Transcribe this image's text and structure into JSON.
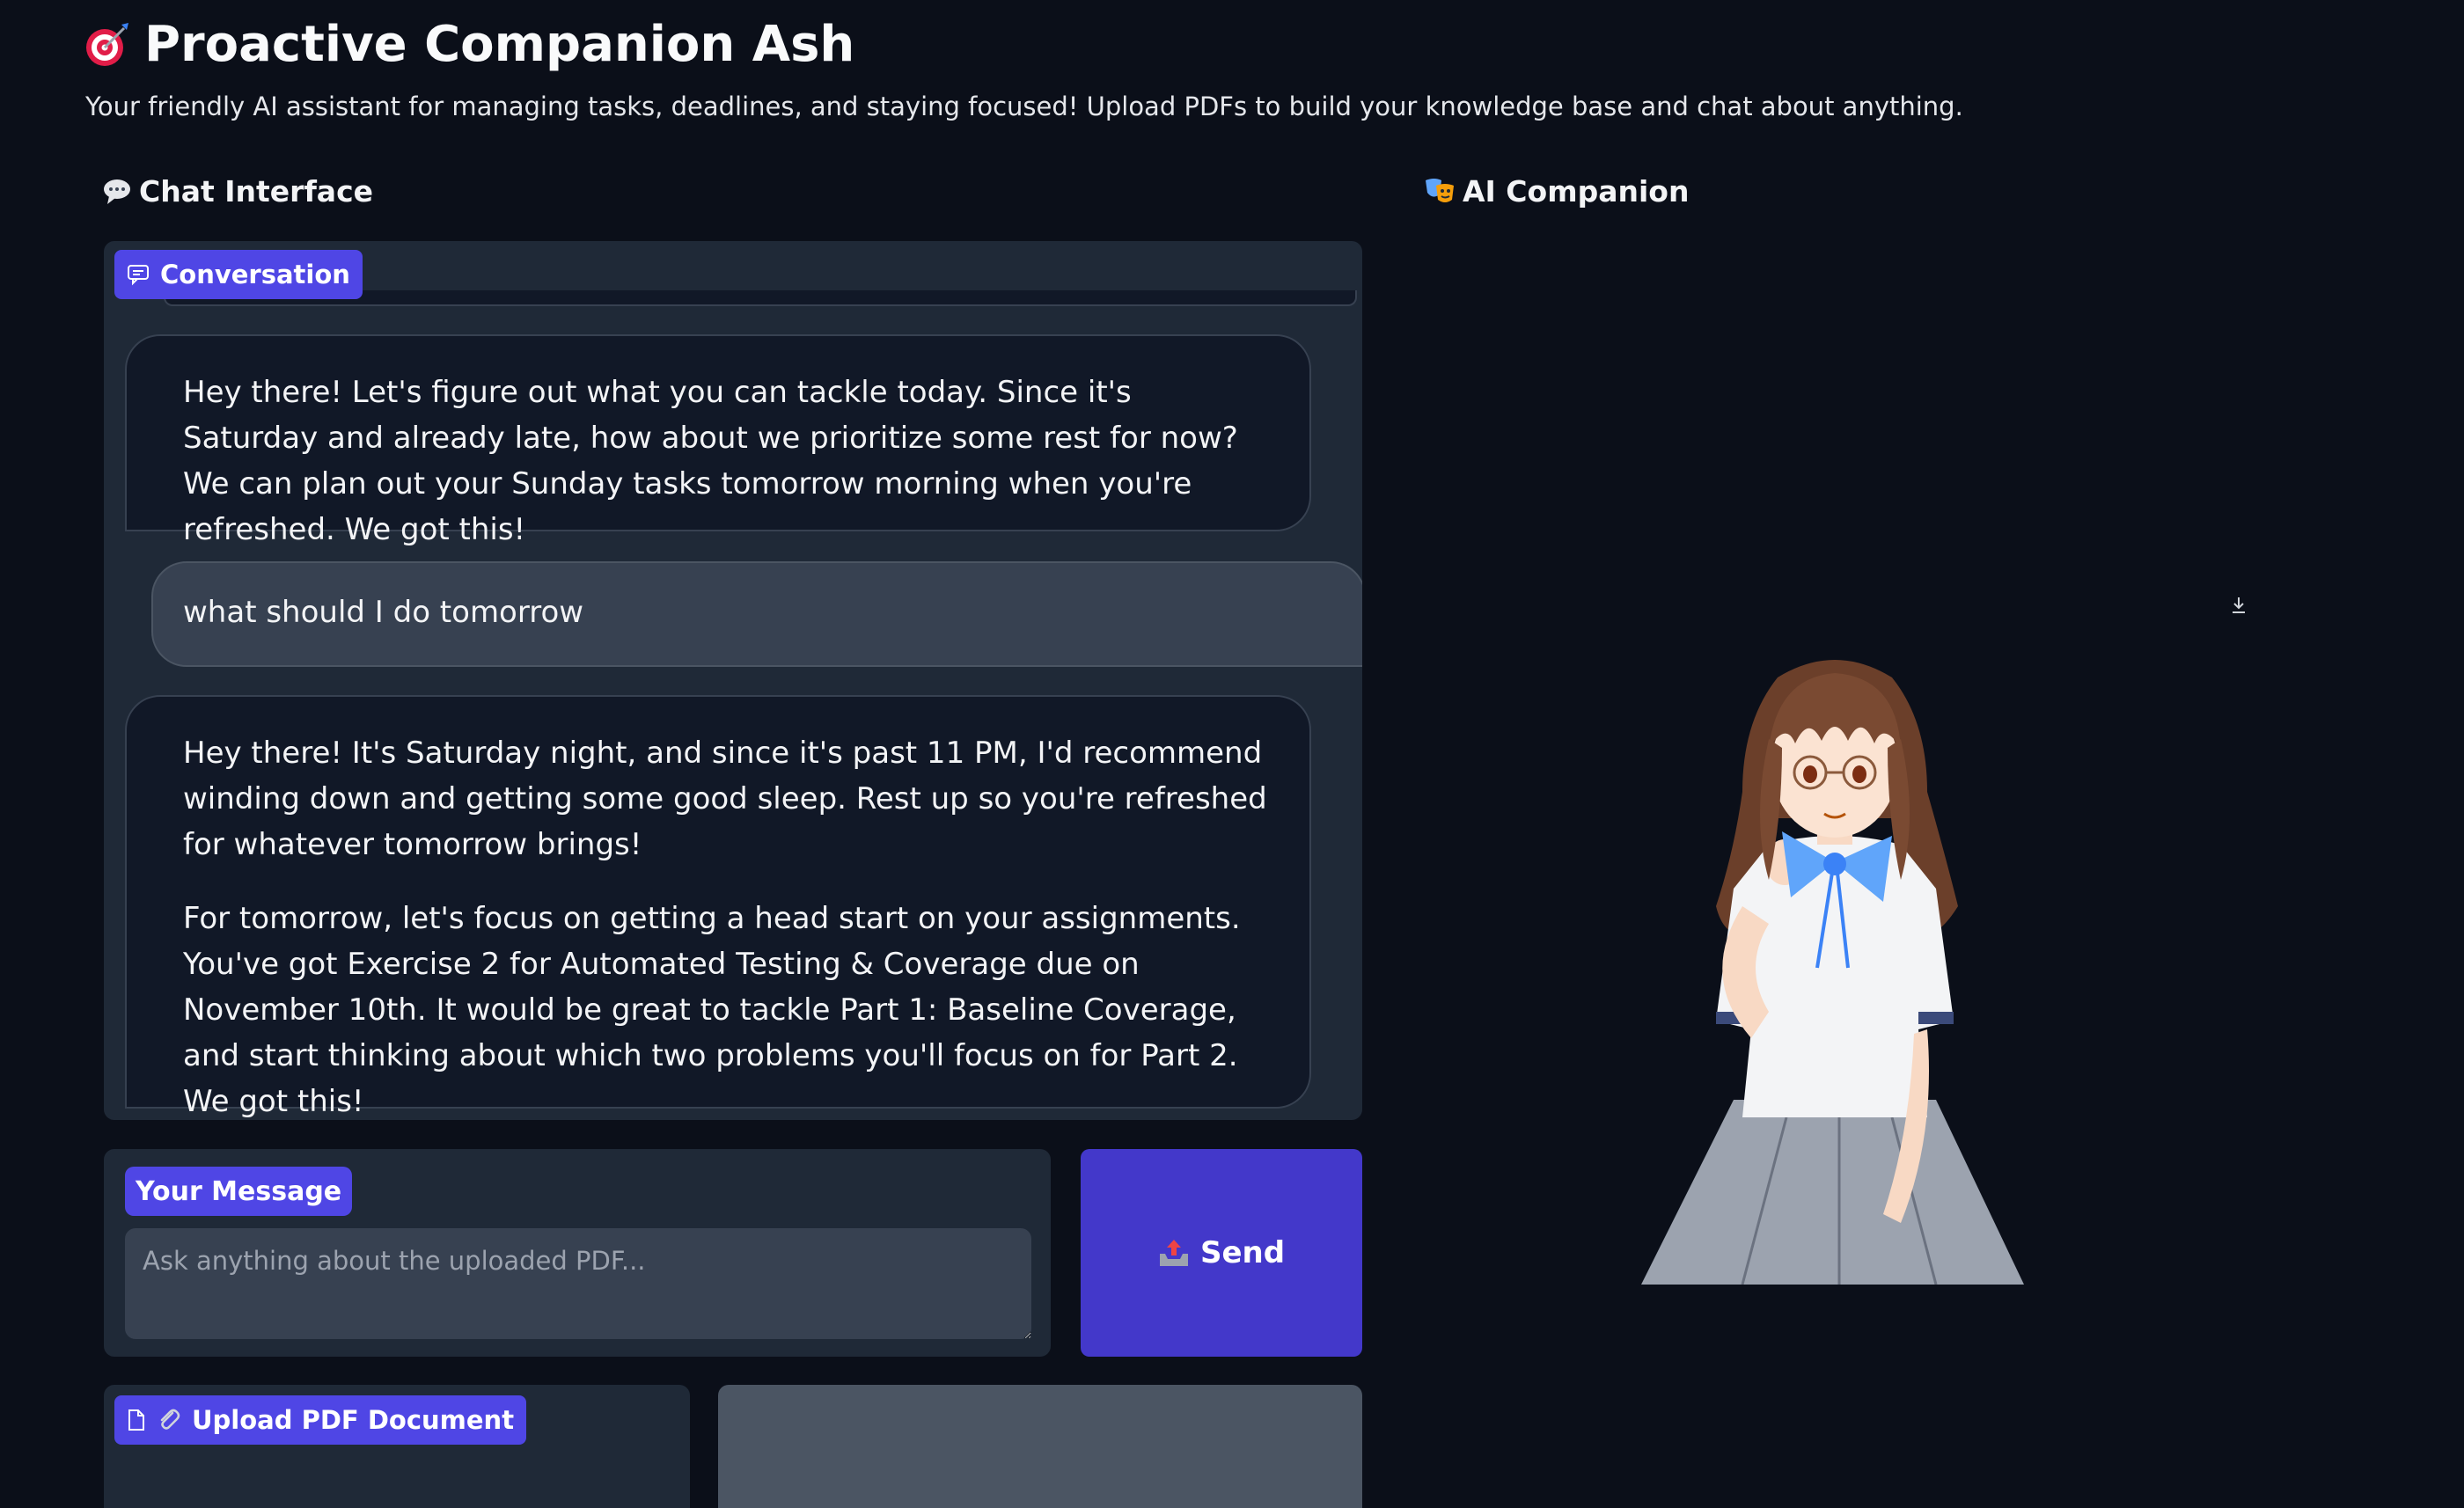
{
  "app": {
    "title_icon": "target-dart-icon",
    "title": "Proactive Companion Ash",
    "subtitle": "Your friendly AI assistant for managing tasks, deadlines, and staying focused! Upload PDFs to build your knowledge base and chat about anything."
  },
  "chat": {
    "heading_icon": "speech-bubble-icon",
    "heading": "Chat Interface",
    "conversation_label": "Conversation",
    "messages": [
      {
        "role": "assistant",
        "paragraphs": [
          "Hey there! Let's figure out what you can tackle today. Since it's Saturday and already late, how about we prioritize some rest for now? We can plan out your Sunday tasks tomorrow morning when you're refreshed. We got this!"
        ]
      },
      {
        "role": "user",
        "text": "what should I do tomorrow"
      },
      {
        "role": "assistant",
        "paragraphs": [
          "Hey there! It's Saturday night, and since it's past 11 PM, I'd recommend winding down and getting some good sleep. Rest up so you're refreshed for whatever tomorrow brings!",
          "For tomorrow, let's focus on getting a head start on your assignments. You've got Exercise 2 for Automated Testing & Coverage due on November 10th. It would be great to tackle Part 1: Baseline Coverage, and start thinking about which two problems you'll focus on for Part 2. We got this!"
        ]
      }
    ]
  },
  "input": {
    "label": "Your Message",
    "value": "",
    "placeholder": "Ask anything about the uploaded PDF..."
  },
  "send": {
    "icon": "outbox-tray-icon",
    "label": "Send"
  },
  "upload": {
    "icon": "paperclip-icon",
    "label": "Upload PDF Document"
  },
  "companion": {
    "heading_icon": "performing-arts-icon",
    "heading": "AI Companion",
    "download_icon": "download-icon"
  },
  "colors": {
    "background": "#0b0f19",
    "panel": "#1f2937",
    "accent": "#4f46e5",
    "send_button": "#4338ca"
  }
}
